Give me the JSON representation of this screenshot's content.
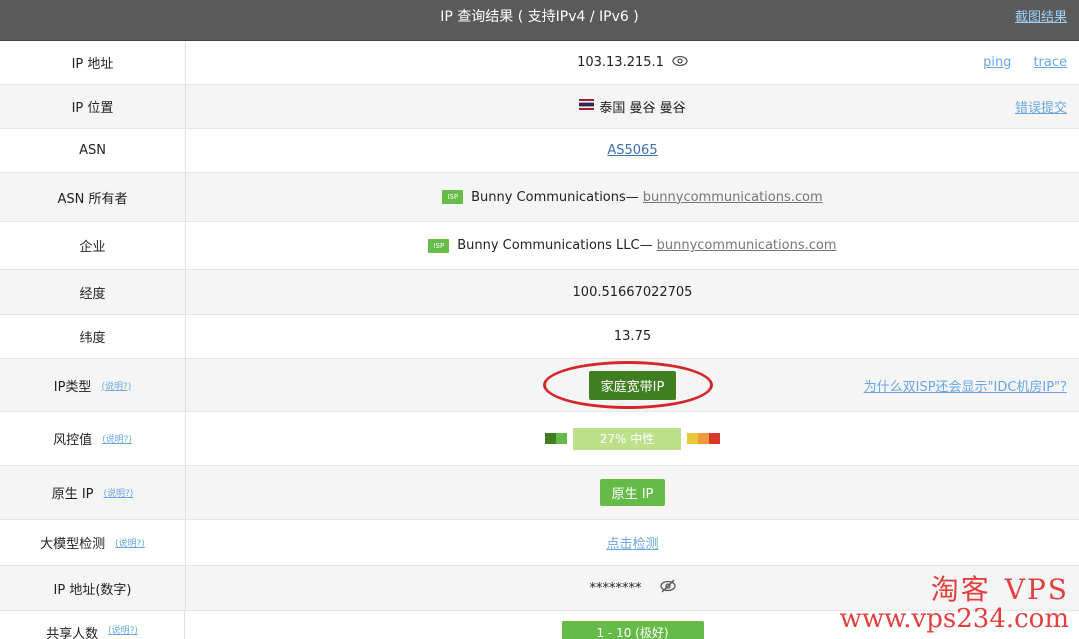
{
  "header": {
    "title": "IP 查询结果 ( 支持IPv4 / IPv6 )",
    "screenshot_link": "截图结果"
  },
  "help_text": "(说明?)",
  "rows": {
    "ip": {
      "label": "IP 地址",
      "value": "103.13.215.1",
      "ping": "ping",
      "trace": "trace"
    },
    "location": {
      "label": "IP 位置",
      "value": "泰国 曼谷 曼谷",
      "report": "错误提交"
    },
    "asn": {
      "label": "ASN",
      "value": "AS5065"
    },
    "asn_owner": {
      "label": "ASN 所有者",
      "isp_tag": "ISP",
      "name": "Bunny Communications—",
      "domain": "bunnycommunications.com"
    },
    "company": {
      "label": "企业",
      "isp_tag": "ISP",
      "name": "Bunny Communications LLC—",
      "domain": "bunnycommunications.com"
    },
    "longitude": {
      "label": "经度",
      "value": "100.51667022705"
    },
    "latitude": {
      "label": "纬度",
      "value": "13.75"
    },
    "ip_type": {
      "label": "IP类型",
      "value": "家庭宽带IP",
      "why": "为什么双ISP还会显示\"IDC机房IP\"?"
    },
    "risk": {
      "label": "风控值",
      "value": "27%   中性"
    },
    "native": {
      "label": "原生 IP",
      "value": "原生 IP"
    },
    "llm": {
      "label": "大模型检测",
      "value": "点击检测"
    },
    "ip_numeric": {
      "label": "IP 地址(数字)",
      "value": "********"
    },
    "shared": {
      "label": "共享人数",
      "value": "1 - 10 (极好)"
    }
  },
  "colors": {
    "header": "#5a5a5a",
    "green": "#66bb48",
    "dark_green": "#3f7f22",
    "link": "#6aa7e0",
    "watermark": "#e23f3f",
    "circle": "#d42828"
  },
  "watermark": {
    "cn": "淘客",
    "vps": "VPS",
    "url": "www.vps234.com"
  }
}
